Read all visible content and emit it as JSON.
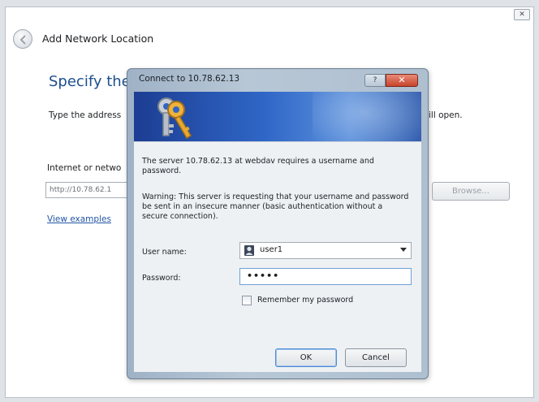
{
  "wizard": {
    "title": "Add Network Location",
    "close_glyph": "✕",
    "heading": "Specify the lo",
    "instruction": "Type the address",
    "instruction_end": "ill open.",
    "address_label": "Internet or netwo",
    "address_value": "http://10.78.62.1",
    "browse_label": "Browse...",
    "view_examples_label": "View examples"
  },
  "dialog": {
    "title": "Connect to 10.78.62.13",
    "help_glyph": "?",
    "close_glyph": "✕",
    "message": "The server 10.78.62.13 at webdav requires a username and password.",
    "warning": "Warning: This server is requesting that your username and password be sent in an insecure manner (basic authentication without a secure connection).",
    "username_label": "User name:",
    "username_value": "user1",
    "password_label": "Password:",
    "password_value": "•••••",
    "remember_label": "Remember my password",
    "remember_checked": false,
    "ok_label": "OK",
    "cancel_label": "Cancel"
  },
  "icons": {
    "back": "back-arrow-icon",
    "keys": "keys-icon",
    "user": "user-icon",
    "dropdown": "chevron-down-icon"
  },
  "colors": {
    "heading": "#1e4f8e",
    "link": "#2255a4",
    "banner": "#2f66c6",
    "close_button": "#c7452c"
  }
}
